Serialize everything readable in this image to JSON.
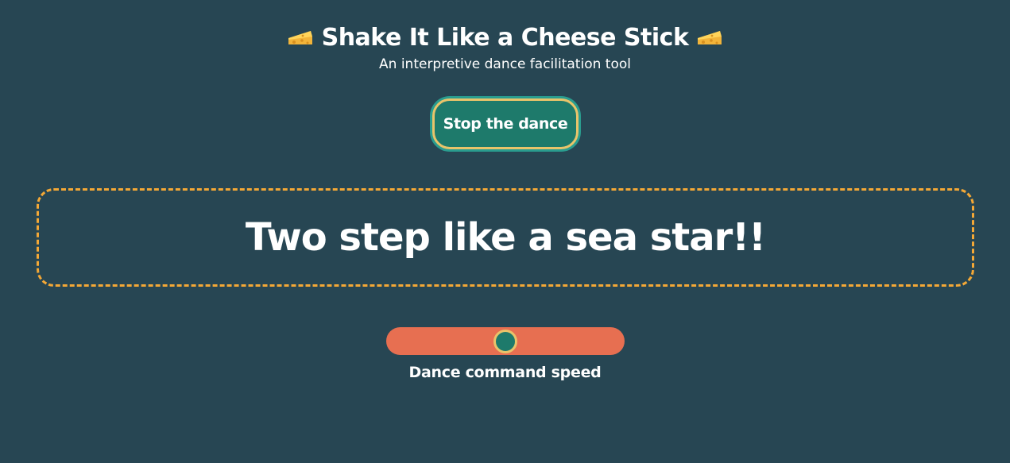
{
  "header": {
    "title": "Shake It Like a Cheese Stick",
    "title_icon": "cheese-icon",
    "subtitle": "An interpretive dance facilitation tool"
  },
  "controls": {
    "stop_label": "Stop the dance"
  },
  "command": {
    "text": "Two step like a sea star!!"
  },
  "speed": {
    "label": "Dance command speed",
    "value": 0.5
  },
  "colors": {
    "background": "#274653",
    "button_fill": "#1e7a6b",
    "button_border": "#e9c46a",
    "dashed_border": "#f4a836",
    "slider_track": "#e76f51"
  }
}
